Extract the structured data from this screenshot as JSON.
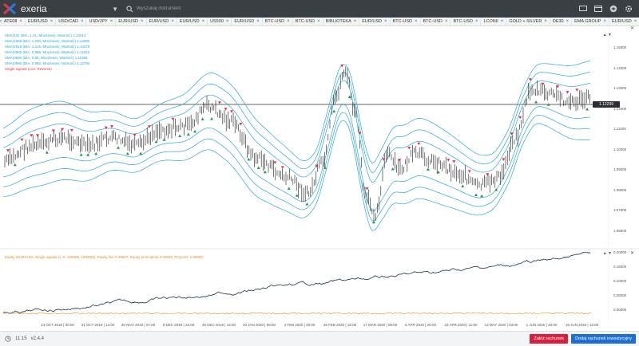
{
  "app": {
    "name": "exeria"
  },
  "search": {
    "placeholder": "Wyszukaj instrument"
  },
  "tabs": [
    "ATE08",
    "EUR/USD",
    "USD/CAD",
    "USD/JPY",
    "EUR/USD",
    "EUR/USD",
    "EUR/USD",
    "US500",
    "EUR/USD",
    "BTC-USD",
    "BTC-USD",
    "BIBLIOTEKA",
    "EUR/USD",
    "BTC-USD",
    "BTC-USD",
    "BTC-USD",
    "LCONII",
    "GOLD + SILVER",
    "DE30",
    "EMA GROUP",
    "EUR/USD"
  ],
  "legend": [
    {
      "text": "SMA(121 (BIA, 1.21, Mnożenie), Wartość) 1.13014",
      "color": "#29a8d8"
    },
    {
      "text": "SMA(1650 (BIA, 1.000, Mnożenie), Wartość) 1.12082",
      "color": "#29a8d8"
    },
    {
      "text": "SMA(1515 (BIA, 1.015, Mnożenie), Wartość) 1.14278",
      "color": "#29a8d8"
    },
    {
      "text": "SMA(0985 (BIA, 0.985, Mnożenie), Wartość) 1.11023",
      "color": "#29a8d8"
    },
    {
      "text": "SMA(0990 (BIA, 0.99, Mnożenie), Wartość) 1.11266",
      "color": "#29a8d8"
    },
    {
      "text": "SMA(0980 (BIA, 0.980, Mnożenie), Wartość) 1.13784",
      "color": "#29a8d8"
    },
    {
      "text": "Single signals (Lon. Reverse)",
      "color": "#e8334a"
    }
  ],
  "price": {
    "current": "1.12299"
  },
  "y_axis_top": [
    "1.15000",
    "1.14000",
    "1.13000",
    "1.12000",
    "1.11000",
    "1.10000",
    "1.09000",
    "1.08000",
    "1.07000",
    "1.06000"
  ],
  "y_axis_bottom": [
    "0.20000",
    "0.15000",
    "0.10000",
    "0.05000",
    "0.00000"
  ],
  "x_axis": [
    "14 OCT 2019 | 00:00",
    "31 OCT 2019 | 14:00",
    "20 NOV 2019 | 07:00",
    "9 DEC 2019 | 23:00",
    "30 DEC 2019 | 14:00",
    "20 JAN 2020 | 06:00",
    "4 FEB 2020 | 20:00",
    "26 FEB 2020 | 15:00",
    "17 MAR 2020 | 06:00",
    "5 APR 2020 | 20:00",
    "23 APR 2020 | 11:00",
    "13 MAY 2020 | 03:00",
    "1 JUN 2020 | 20:00",
    "19 JUN 2020 | 12:00"
  ],
  "equity_legend": "Equity (EUR/USD, Single signals (L-S, 100000, 100000)), Equity line 0.19667, Equity przeciętnie 0.00000, Przyrost -1.00000",
  "status": {
    "time": "11:15",
    "version": "v2.4.4"
  },
  "buttons": {
    "open_account": "Załóż rachunek",
    "add_investment": "Dodaj rachunek inwestycyjny"
  },
  "colors": {
    "topbar": "#3a3f44",
    "band": "#29a8d8",
    "candle": "#1a1a1a",
    "buy": "#1e9e4a",
    "sell": "#e8334a",
    "equity": "#34495e",
    "equity_accent": "#e58a2a",
    "accent_red": "#d5213f",
    "accent_blue": "#1f6fd1"
  }
}
